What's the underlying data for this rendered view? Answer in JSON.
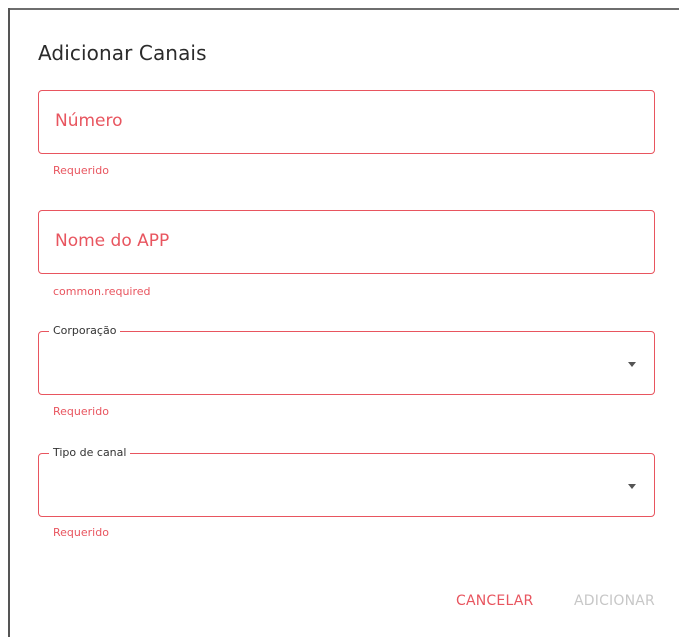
{
  "dialog": {
    "title": "Adicionar Canais"
  },
  "fields": {
    "numero": {
      "placeholder": "Número",
      "helper": "Requerido"
    },
    "nome_app": {
      "placeholder": "Nome do APP",
      "helper": "common.required"
    },
    "corporacao": {
      "label": "Corporação",
      "helper": "Requerido"
    },
    "tipo_canal": {
      "label": "Tipo de canal",
      "helper": "Requerido"
    }
  },
  "actions": {
    "cancel_label": "CANCELAR",
    "add_label": "ADICIONAR"
  },
  "colors": {
    "error": "#e8555f",
    "disabled": "#c7c7c7",
    "text": "#2b2b2b"
  },
  "icons": {
    "select_caret": "caret-down-icon"
  }
}
